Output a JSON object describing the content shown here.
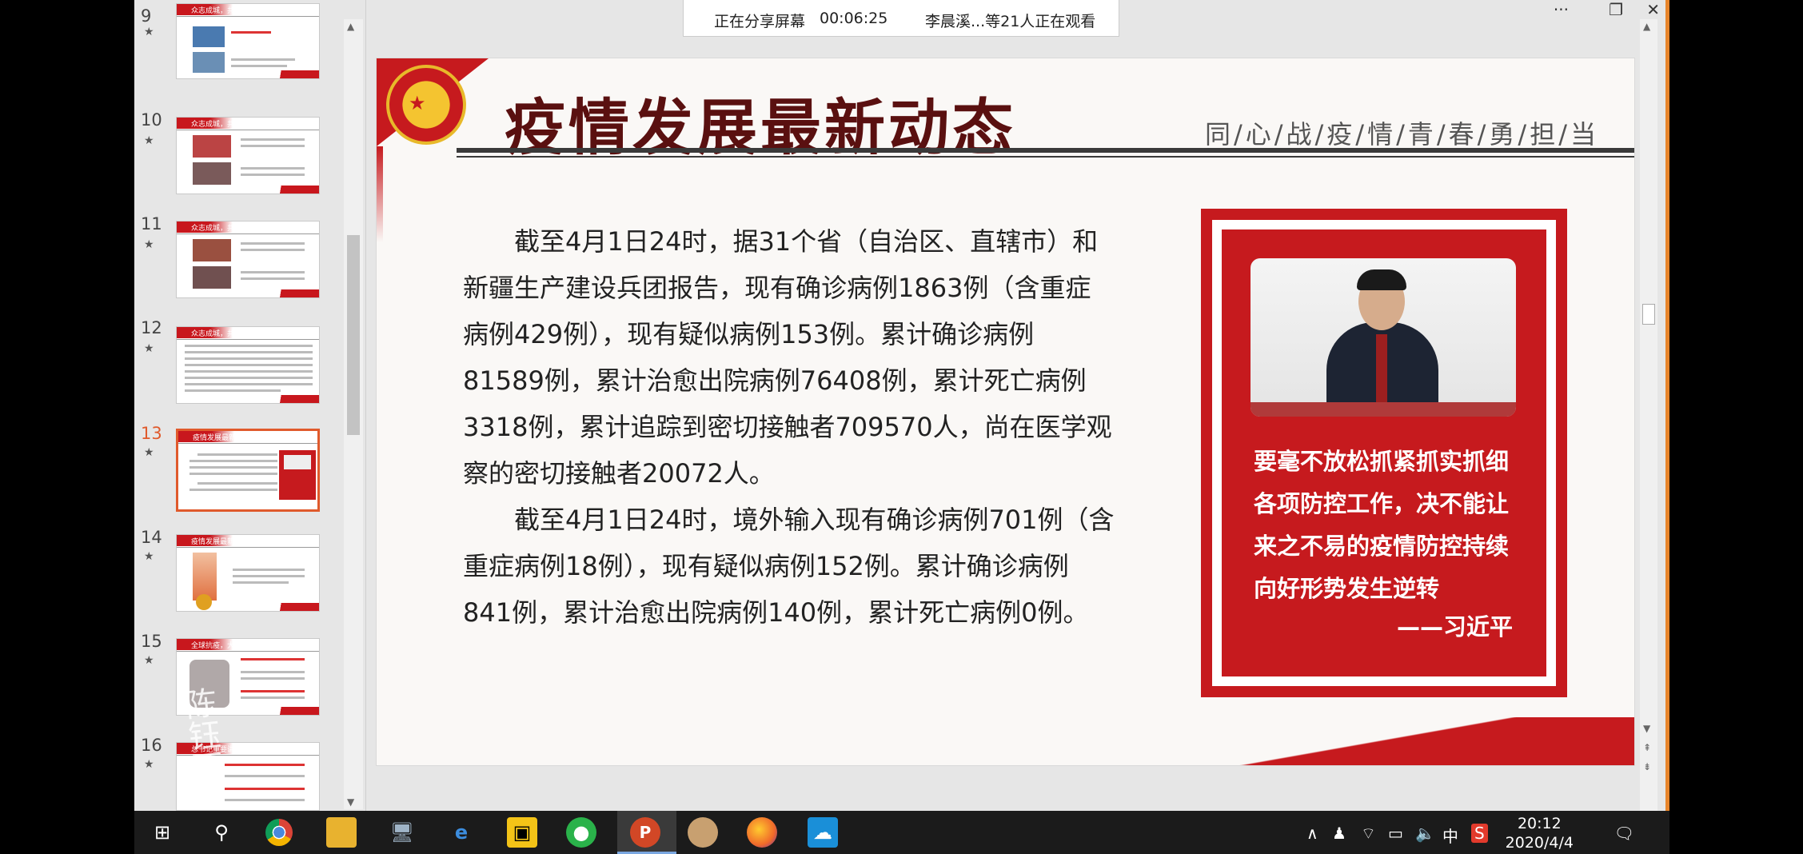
{
  "share_bar": {
    "status": "正在分享屏幕",
    "duration": "00:06:25",
    "viewers": "李晨溪...等21人正在观看"
  },
  "thumbnails": [
    {
      "num": "9",
      "title": "众志成城，共同抗疫"
    },
    {
      "num": "10",
      "title": "众志成城，共同抗疫"
    },
    {
      "num": "11",
      "title": "众志成城，共同抗疫"
    },
    {
      "num": "12",
      "title": "众志成城，共同抗疫"
    },
    {
      "num": "13",
      "title": "疫情发展最新动态"
    },
    {
      "num": "14",
      "title": "疫情发展最新动态"
    },
    {
      "num": "15",
      "title": "全球抗疫，大国担当"
    },
    {
      "num": "16",
      "title": "总书记重要讲话"
    }
  ],
  "selected_slide": "13",
  "slide": {
    "title": "疫情发展最新动态",
    "subtitle": "同/心/战/疫/情/青/春/勇/担/当",
    "paragraph1": "截至4月1日24时，据31个省（自治区、直辖市）和新疆生产建设兵团报告，现有确诊病例1863例（含重症病例429例），现有疑似病例153例。累计确诊病例81589例，累计治愈出院病例76408例，累计死亡病例3318例，累计追踪到密切接触者709570人，尚在医学观察的密切接触者20072人。",
    "paragraph2": "截至4月1日24时，境外输入现有确诊病例701例（含重症病例18例），现有疑似病例152例。累计确诊病例841例，累计治愈出院病例140例，累计死亡病例0例。",
    "quote": "要毫不放松抓紧抓实抓细各项防控工作，决不能让来之不易的疫情防控持续向好形势发生逆转",
    "quote_author": "——习近平"
  },
  "overlay_handwriting": "陈钰栗",
  "taskbar": {
    "ime": "中",
    "time": "20:12",
    "date": "2020/4/4"
  },
  "colors": {
    "slide_red": "#c61a1e",
    "title_brown": "#5a1010",
    "selection_orange": "#e05a2c"
  }
}
